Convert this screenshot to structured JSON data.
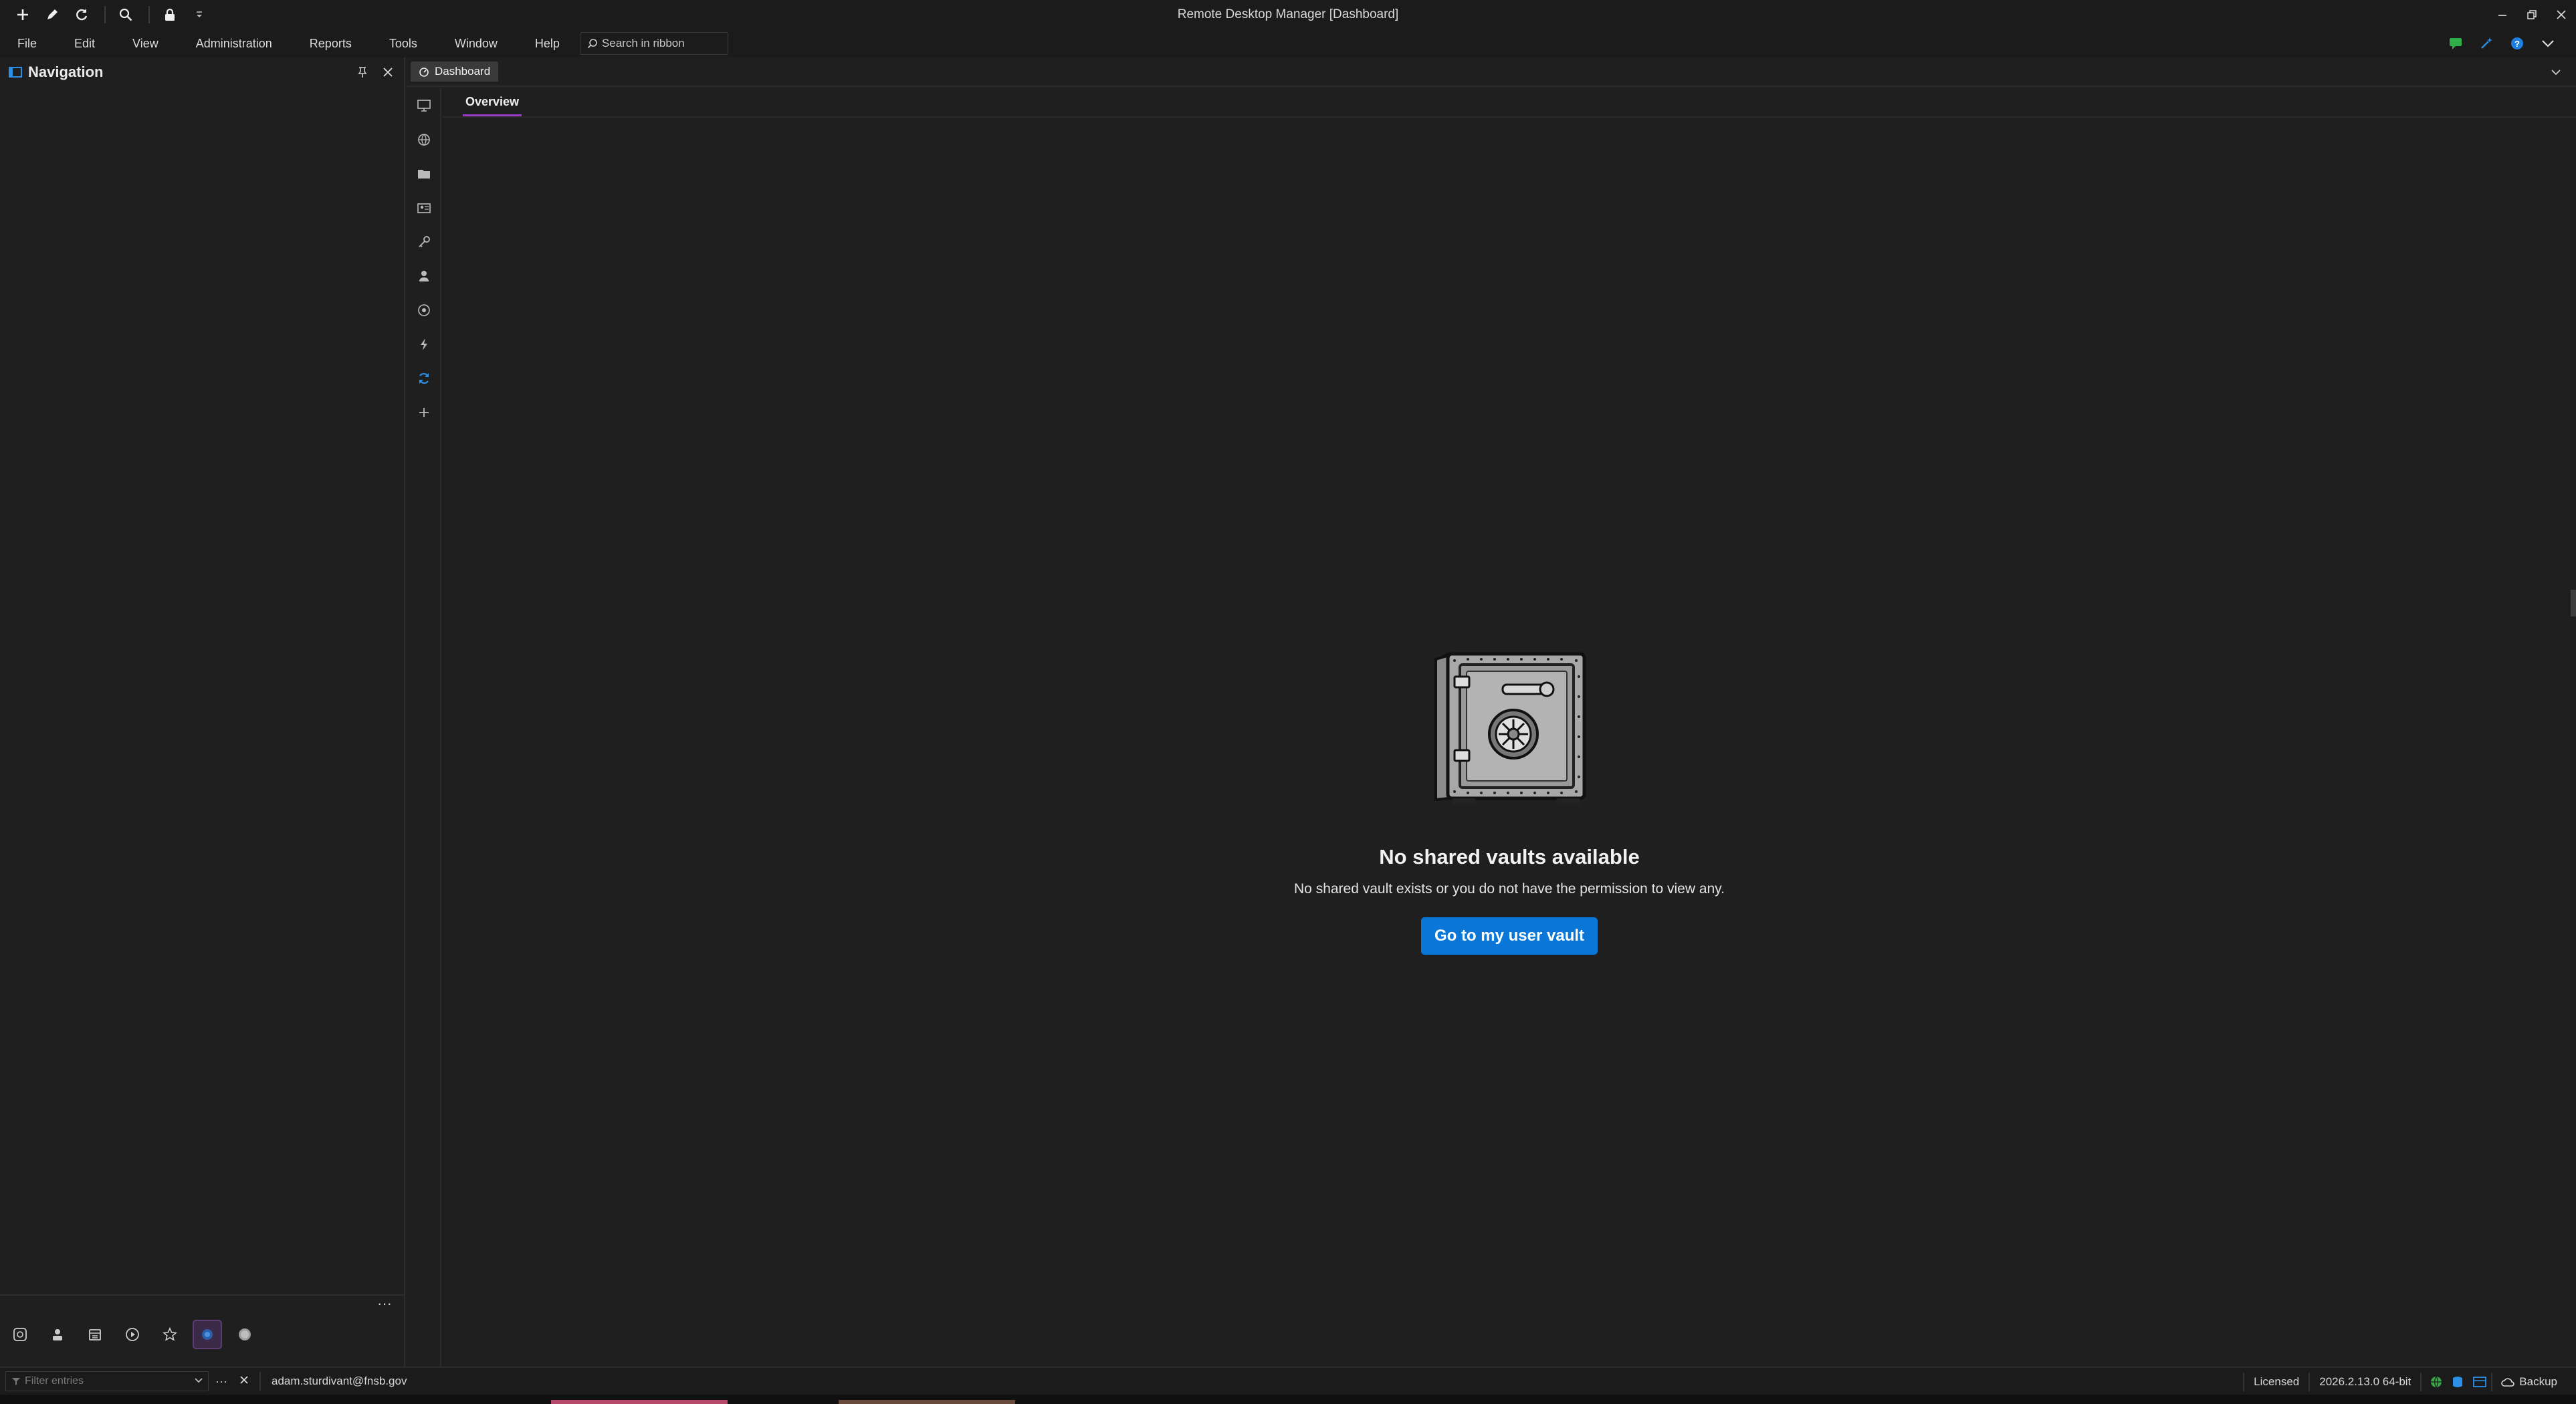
{
  "window": {
    "title": "Remote Desktop Manager [Dashboard]"
  },
  "quick_access": {
    "icons": [
      "add-icon",
      "edit-icon",
      "refresh-icon",
      "search-icon",
      "lock-icon",
      "customize-dropdown-icon"
    ]
  },
  "menu": {
    "items": [
      "File",
      "Edit",
      "View",
      "Administration",
      "Reports",
      "Tools",
      "Window",
      "Help"
    ],
    "search_placeholder": "Search in ribbon"
  },
  "navigation": {
    "title": "Navigation"
  },
  "tabs": {
    "active_tab": "Dashboard",
    "subtab": "Overview"
  },
  "empty_state": {
    "title": "No shared vaults available",
    "description": "No shared vault exists or you do not have the permission to view any.",
    "button_label": "Go to my user vault"
  },
  "statusbar": {
    "filter_placeholder": "Filter entries",
    "user": "adam.sturdivant@fnsb.gov",
    "license": "Licensed",
    "version": "2026.2.13.0 64-bit",
    "backup": "Backup"
  },
  "colors": {
    "accent": "#0a76d8",
    "tab_underline": "#9b3cc8",
    "background": "#1f1f1f"
  }
}
